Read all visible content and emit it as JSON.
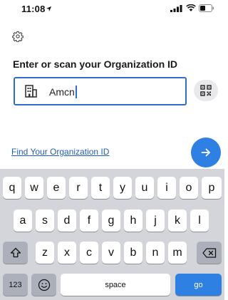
{
  "status_bar": {
    "time": "11:08"
  },
  "header": {
    "settings_icon": "gear-icon"
  },
  "main": {
    "prompt": "Enter or scan your Organization ID",
    "org_input": {
      "value": "Amcn",
      "icon": "building-icon"
    },
    "qr_button_icon": "qr-code-icon",
    "find_link": "Find Your Organization ID",
    "next_button_icon": "arrow-right-icon"
  },
  "keyboard": {
    "row1": [
      "q",
      "w",
      "e",
      "r",
      "t",
      "y",
      "u",
      "i",
      "o",
      "p"
    ],
    "row2": [
      "a",
      "s",
      "d",
      "f",
      "g",
      "h",
      "j",
      "k",
      "l"
    ],
    "row3": [
      "z",
      "x",
      "c",
      "v",
      "b",
      "n",
      "m"
    ],
    "numbers_label": "123",
    "space_label": "space",
    "go_label": "go"
  },
  "colors": {
    "accent": "#2f80e3",
    "link": "#1f5fb8",
    "keyboard_bg": "#d3d5da"
  }
}
